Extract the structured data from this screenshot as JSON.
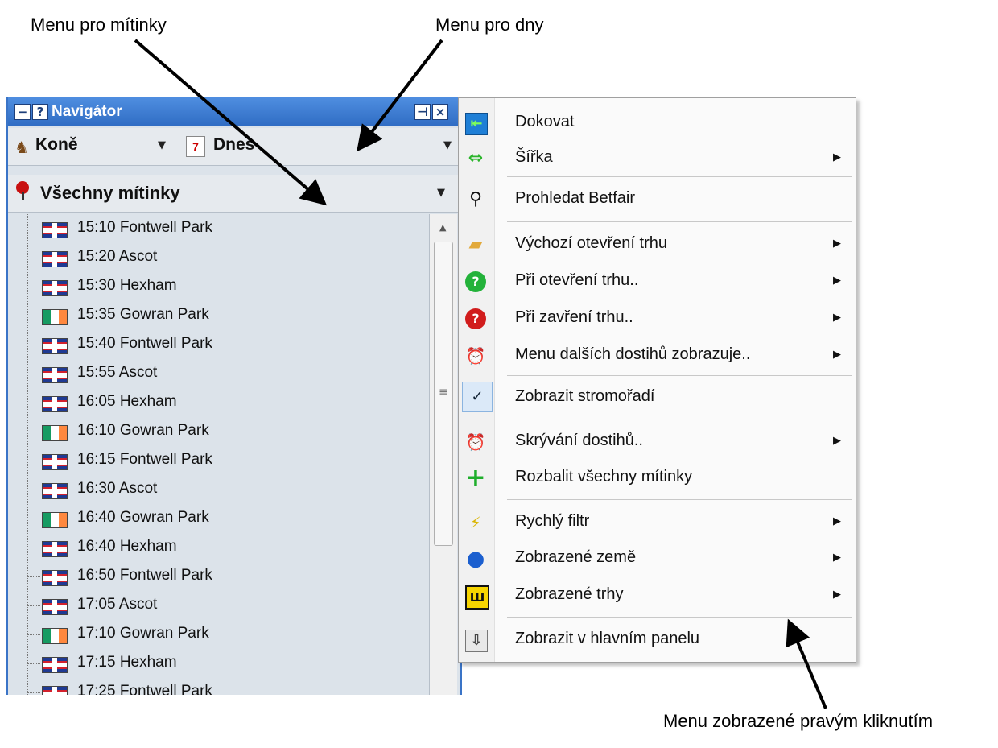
{
  "annotations": {
    "meetings_menu": "Menu pro mítinky",
    "days_menu": "Menu pro dny",
    "right_click_menu": "Menu zobrazené pravým kliknutím"
  },
  "navigator": {
    "title": "Navigátor",
    "sport": "Koně",
    "day": "Dnes",
    "meetings_filter": "Všechny mítinky",
    "races": [
      {
        "label": "15:10 Fontwell Park",
        "flag": "uk"
      },
      {
        "label": "15:20 Ascot",
        "flag": "uk"
      },
      {
        "label": "15:30 Hexham",
        "flag": "uk"
      },
      {
        "label": "15:35 Gowran Park",
        "flag": "ie"
      },
      {
        "label": "15:40 Fontwell Park",
        "flag": "uk"
      },
      {
        "label": "15:55 Ascot",
        "flag": "uk"
      },
      {
        "label": "16:05 Hexham",
        "flag": "uk"
      },
      {
        "label": "16:10 Gowran Park",
        "flag": "ie"
      },
      {
        "label": "16:15 Fontwell Park",
        "flag": "uk"
      },
      {
        "label": "16:30 Ascot",
        "flag": "uk"
      },
      {
        "label": "16:40 Gowran Park",
        "flag": "ie"
      },
      {
        "label": "16:40 Hexham",
        "flag": "uk"
      },
      {
        "label": "16:50 Fontwell Park",
        "flag": "uk"
      },
      {
        "label": "17:05 Ascot",
        "flag": "uk"
      },
      {
        "label": "17:10 Gowran Park",
        "flag": "ie"
      },
      {
        "label": "17:15 Hexham",
        "flag": "uk"
      },
      {
        "label": "17:25 Fontwell Park",
        "flag": "uk"
      }
    ]
  },
  "context_menu": {
    "items": [
      {
        "label": "Dokovat",
        "icon": "dock-icon",
        "submenu": false
      },
      {
        "label": "Šířka",
        "icon": "width-arrows-icon",
        "submenu": true
      },
      {
        "label": "Prohledat Betfair",
        "icon": "binoculars-icon",
        "submenu": false
      },
      {
        "label": "Výchozí otevření trhu",
        "icon": "folder-open-icon",
        "submenu": true
      },
      {
        "label": "Při otevření trhu..",
        "icon": "green-question-icon",
        "submenu": true
      },
      {
        "label": "Při zavření trhu..",
        "icon": "red-question-icon",
        "submenu": true
      },
      {
        "label": "Menu dalších dostihů zobrazuje..",
        "icon": "alarm-clock-icon",
        "submenu": true
      },
      {
        "label": "Zobrazit stromořadí",
        "icon": "checkmark-icon",
        "submenu": false,
        "checked": true
      },
      {
        "label": "Skrývání dostihů..",
        "icon": "alarm-clock-icon",
        "submenu": true
      },
      {
        "label": "Rozbalit všechny mítinky",
        "icon": "plus-icon",
        "submenu": false
      },
      {
        "label": "Rychlý filtr",
        "icon": "filter-lightning-icon",
        "submenu": true
      },
      {
        "label": "Zobrazené země",
        "icon": "globe-icon",
        "submenu": true
      },
      {
        "label": "Zobrazené trhy",
        "icon": "markets-icon",
        "submenu": true
      },
      {
        "label": "Zobrazit v hlavním panelu",
        "icon": "down-arrow-icon",
        "submenu": false
      }
    ]
  }
}
